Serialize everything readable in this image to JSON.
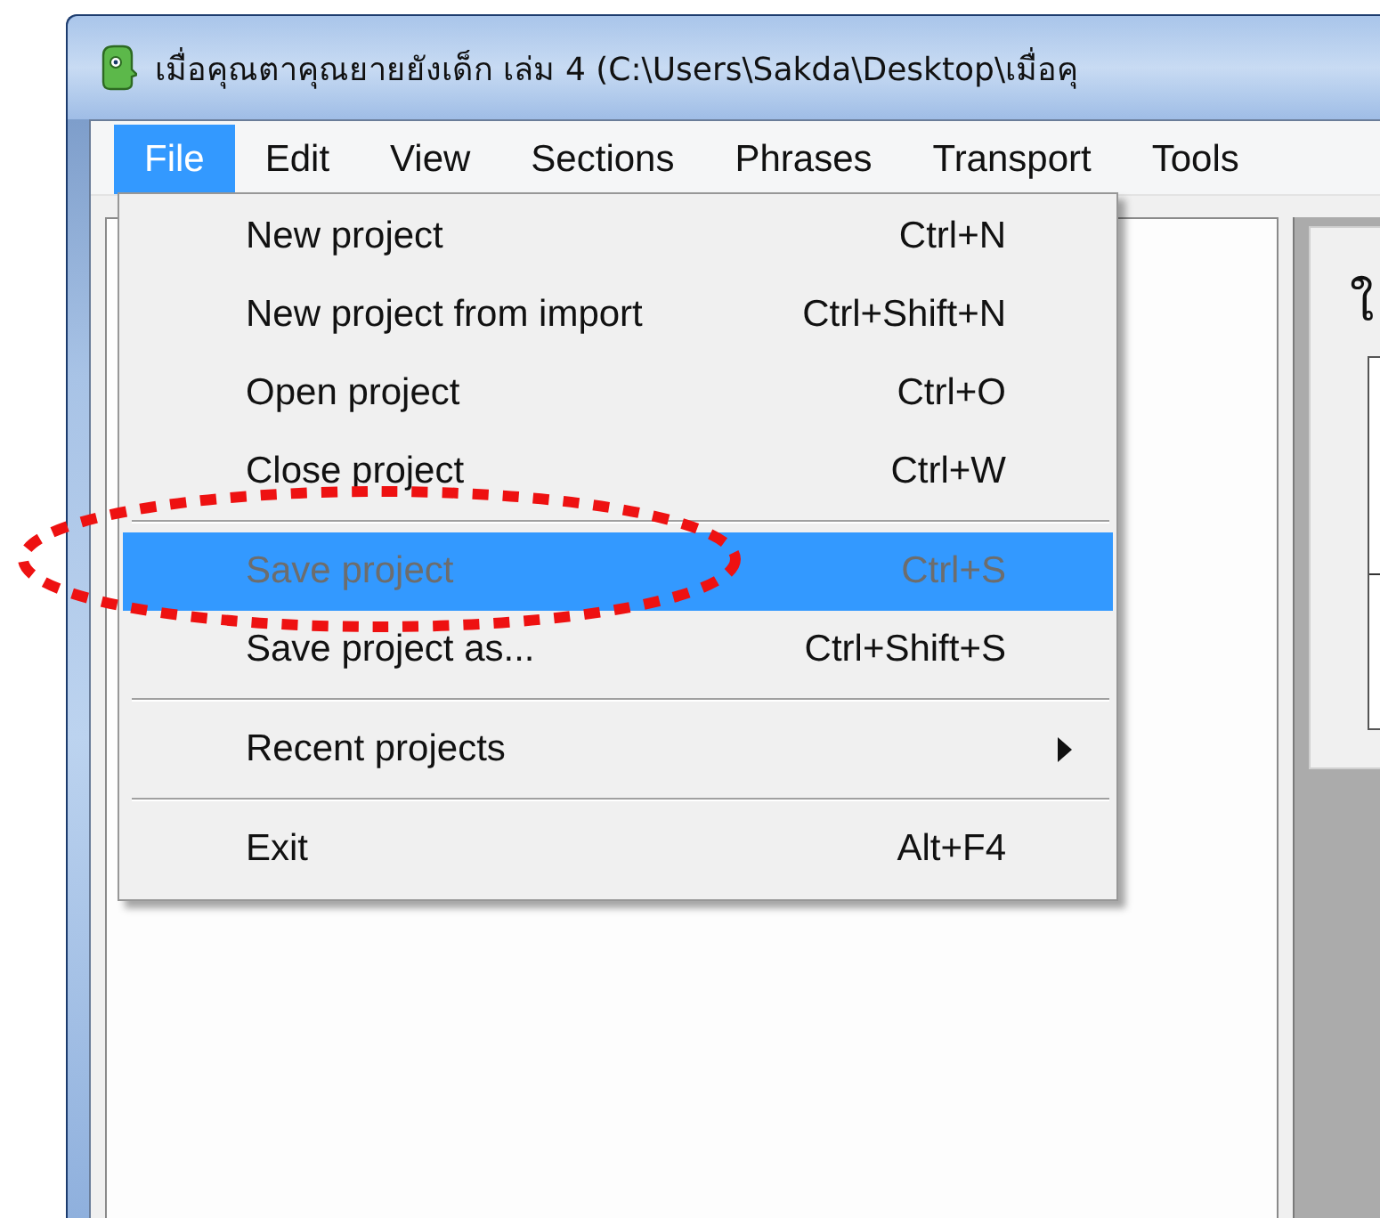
{
  "window": {
    "title": "เมื่อคุณตาคุณยายยังเด็ก เล่ม 4 (C:\\Users\\Sakda\\Desktop\\เมื่อคุ"
  },
  "menu_bar": [
    {
      "label": "File",
      "selected": true
    },
    {
      "label": "Edit",
      "selected": false
    },
    {
      "label": "View",
      "selected": false
    },
    {
      "label": "Sections",
      "selected": false
    },
    {
      "label": "Phrases",
      "selected": false
    },
    {
      "label": "Transport",
      "selected": false
    },
    {
      "label": "Tools",
      "selected": false
    }
  ],
  "file_menu": [
    {
      "kind": "item",
      "label": "New project",
      "shortcut": "Ctrl+N",
      "disabled": false,
      "selected": false
    },
    {
      "kind": "item",
      "label": "New project from import",
      "shortcut": "Ctrl+Shift+N",
      "disabled": false,
      "selected": false
    },
    {
      "kind": "item",
      "label": "Open project",
      "shortcut": "Ctrl+O",
      "disabled": false,
      "selected": false
    },
    {
      "kind": "item",
      "label": "Close project",
      "shortcut": "Ctrl+W",
      "disabled": false,
      "selected": false
    },
    {
      "kind": "separator"
    },
    {
      "kind": "item",
      "label": "Save project",
      "shortcut": "Ctrl+S",
      "disabled": true,
      "selected": true
    },
    {
      "kind": "item",
      "label": "Save project as...",
      "shortcut": "Ctrl+Shift+S",
      "disabled": false,
      "selected": false
    },
    {
      "kind": "separator"
    },
    {
      "kind": "submenu",
      "label": "Recent projects",
      "disabled": false,
      "selected": false
    },
    {
      "kind": "separator"
    },
    {
      "kind": "item",
      "label": "Exit",
      "shortcut": "Alt+F4",
      "disabled": false,
      "selected": false
    }
  ],
  "side_panel": {
    "heading": "ใ"
  }
}
